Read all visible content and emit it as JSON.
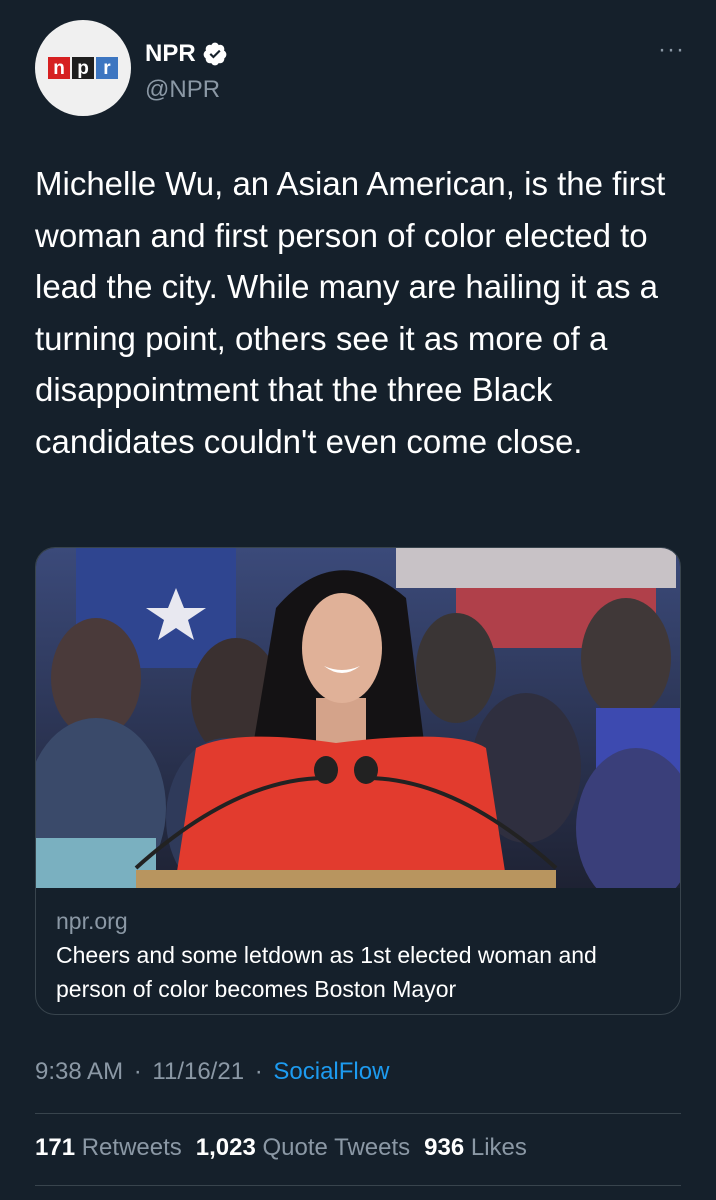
{
  "author": {
    "display_name": "NPR",
    "handle": "@NPR",
    "verified": true,
    "avatar_logo_letters": [
      "n",
      "p",
      "r"
    ]
  },
  "more_label": "···",
  "tweet": {
    "text": "Michelle Wu, an Asian American, is the first woman and first person of color elected to lead the city. While many are hailing it as a turning point, others see it as more of a disappointment that the three Black candidates couldn't even come close."
  },
  "card": {
    "domain": "npr.org",
    "title": "Cheers and some letdown as 1st elected woman and person of color becomes Boston Mayor"
  },
  "meta": {
    "time": "9:38 AM",
    "date": "11/16/21",
    "source": "SocialFlow",
    "separator": "·"
  },
  "stats": [
    {
      "count": "171",
      "label": "Retweets"
    },
    {
      "count": "1,023",
      "label": "Quote Tweets"
    },
    {
      "count": "936",
      "label": "Likes"
    }
  ],
  "colors": {
    "background": "#15202b",
    "secondary_text": "#8b98a5",
    "link": "#1d9bf0",
    "border": "#38444d"
  }
}
